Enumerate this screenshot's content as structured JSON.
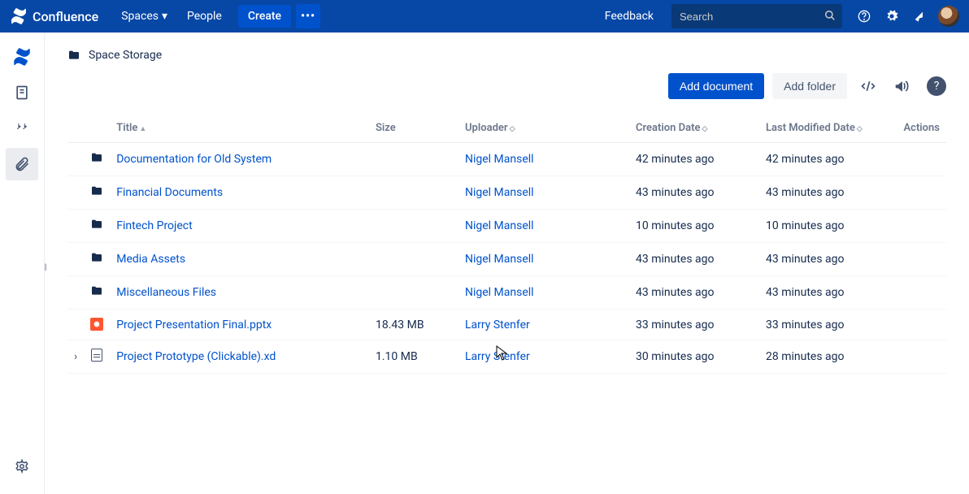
{
  "topbar": {
    "product": "Confluence",
    "spaces": "Spaces",
    "people": "People",
    "create": "Create",
    "feedback": "Feedback",
    "search_placeholder": "Search"
  },
  "breadcrumb": {
    "title": "Space Storage"
  },
  "toolbar": {
    "add_document": "Add document",
    "add_folder": "Add folder"
  },
  "table": {
    "headers": {
      "title": "Title",
      "size": "Size",
      "uploader": "Uploader",
      "creation": "Creation Date",
      "modified": "Last Modified Date",
      "actions": "Actions"
    },
    "rows": [
      {
        "type": "folder",
        "title": "Documentation for Old System",
        "size": "",
        "uploader": "Nigel Mansell",
        "creation": "42 minutes ago",
        "modified": "42 minutes ago"
      },
      {
        "type": "folder",
        "title": "Financial Documents",
        "size": "",
        "uploader": "Nigel Mansell",
        "creation": "43 minutes ago",
        "modified": "43 minutes ago"
      },
      {
        "type": "folder",
        "title": "Fintech Project",
        "size": "",
        "uploader": "Nigel Mansell",
        "creation": "10 minutes ago",
        "modified": "10 minutes ago"
      },
      {
        "type": "folder",
        "title": "Media Assets",
        "size": "",
        "uploader": "Nigel Mansell",
        "creation": "43 minutes ago",
        "modified": "43 minutes ago"
      },
      {
        "type": "folder",
        "title": "Miscellaneous Files",
        "size": "",
        "uploader": "Nigel Mansell",
        "creation": "43 minutes ago",
        "modified": "43 minutes ago"
      },
      {
        "type": "pptx",
        "title": "Project Presentation Final.pptx",
        "size": "18.43 MB",
        "uploader": "Larry Stenfer",
        "creation": "33 minutes ago",
        "modified": "33 minutes ago"
      },
      {
        "type": "file",
        "expandable": true,
        "title": "Project Prototype (Clickable).xd",
        "size": "1.10 MB",
        "uploader": "Larry Stenfer",
        "creation": "30 minutes ago",
        "modified": "28 minutes ago"
      }
    ]
  }
}
